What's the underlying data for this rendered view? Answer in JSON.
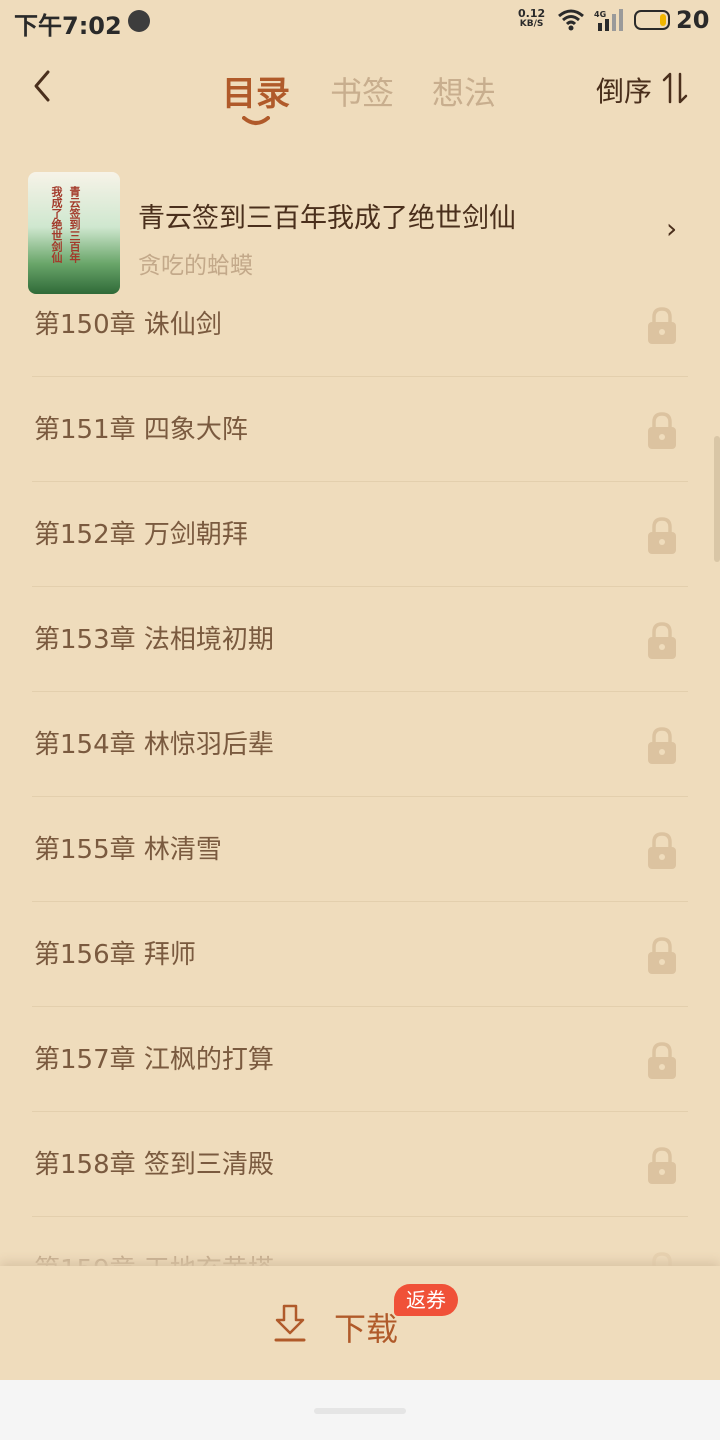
{
  "status_bar": {
    "time": "下午7:02",
    "net_speed_value": "0.12",
    "net_speed_unit": "KB/S",
    "signal_label": "4G",
    "battery": "20"
  },
  "nav": {
    "tabs": [
      {
        "label": "目录",
        "active": true
      },
      {
        "label": "书签",
        "active": false
      },
      {
        "label": "想法",
        "active": false
      }
    ],
    "sort_label": "倒序"
  },
  "book": {
    "title": "青云签到三百年我成了绝世剑仙",
    "author": "贪吃的蛤蟆",
    "arrow": "›",
    "cover_text_1": "我成了绝世剑仙",
    "cover_text_2": "青云签到三百年"
  },
  "chapters": [
    {
      "title": "第150章 诛仙剑",
      "locked": true
    },
    {
      "title": "第151章 四象大阵",
      "locked": true
    },
    {
      "title": "第152章 万剑朝拜",
      "locked": true
    },
    {
      "title": "第153章 法相境初期",
      "locked": true
    },
    {
      "title": "第154章 林惊羽后辈",
      "locked": true
    },
    {
      "title": "第155章 林清雪",
      "locked": true
    },
    {
      "title": "第156章 拜师",
      "locked": true
    },
    {
      "title": "第157章 江枫的打算",
      "locked": true
    },
    {
      "title": "第158章 签到三清殿",
      "locked": true
    },
    {
      "title": "第159章 天地玄黄塔",
      "locked": true
    }
  ],
  "bottom": {
    "download_label": "下载",
    "badge": "返券"
  },
  "colors": {
    "background": "#efdcbc",
    "accent": "#b05a2a",
    "badge": "#f05138"
  },
  "icons": [
    "back-icon",
    "sort-icon",
    "lock-icon",
    "download-icon",
    "wifi-icon",
    "signal-icon",
    "battery-icon"
  ]
}
